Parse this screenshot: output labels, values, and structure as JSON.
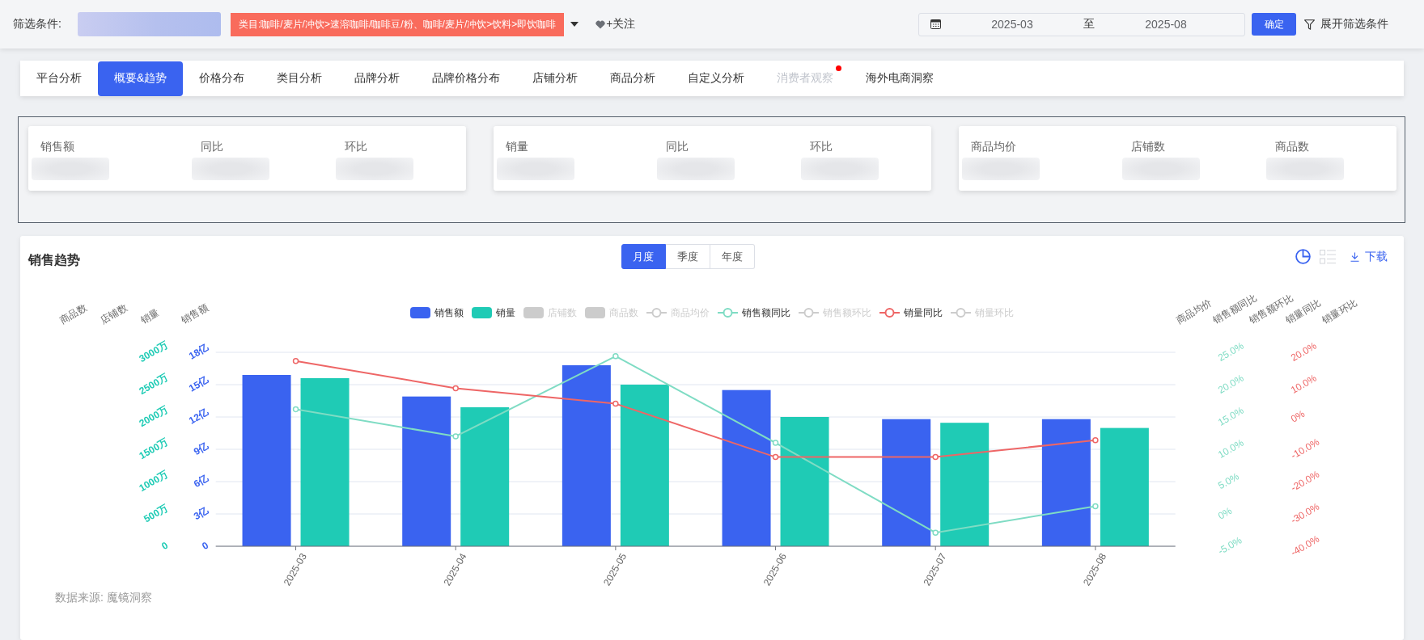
{
  "filter_bar": {
    "label": "筛选条件:",
    "category_tag": "类目:咖啡/麦片/冲饮>速溶咖啡/咖啡豆/粉、咖啡/麦片/冲饮>饮料>即饮咖啡",
    "follow": "+关注",
    "date_range": {
      "start": "2025-03",
      "separator": "至",
      "end": "2025-08"
    },
    "confirm": "确定",
    "expand": "展开筛选条件"
  },
  "tabs": [
    {
      "label": "平台分析",
      "selected": false,
      "disabled": false,
      "dot": false
    },
    {
      "label": "概要&趋势",
      "selected": true,
      "disabled": false,
      "dot": false
    },
    {
      "label": "价格分布",
      "selected": false,
      "disabled": false,
      "dot": false
    },
    {
      "label": "类目分析",
      "selected": false,
      "disabled": false,
      "dot": false
    },
    {
      "label": "品牌分析",
      "selected": false,
      "disabled": false,
      "dot": false
    },
    {
      "label": "品牌价格分布",
      "selected": false,
      "disabled": false,
      "dot": false
    },
    {
      "label": "店铺分析",
      "selected": false,
      "disabled": false,
      "dot": false
    },
    {
      "label": "商品分析",
      "selected": false,
      "disabled": false,
      "dot": false
    },
    {
      "label": "自定义分析",
      "selected": false,
      "disabled": false,
      "dot": false
    },
    {
      "label": "消费者观察",
      "selected": false,
      "disabled": true,
      "dot": true
    },
    {
      "label": "海外电商洞察",
      "selected": false,
      "disabled": false,
      "dot": false
    }
  ],
  "kpi_cards": [
    {
      "metrics": [
        "销售额",
        "同比",
        "环比"
      ]
    },
    {
      "metrics": [
        "销量",
        "同比",
        "环比"
      ]
    },
    {
      "metrics": [
        "商品均价",
        "店铺数",
        "商品数"
      ]
    }
  ],
  "chart_panel": {
    "title": "销售趋势",
    "periods": [
      {
        "label": "月度",
        "selected": true
      },
      {
        "label": "季度",
        "selected": false
      },
      {
        "label": "年度",
        "selected": false
      }
    ],
    "view_modes": [
      {
        "kind": "chart",
        "selected": true
      },
      {
        "kind": "table",
        "selected": false
      }
    ],
    "download": "下载",
    "legend": [
      {
        "on": true
      },
      {
        "on": true
      },
      {
        "label": "店铺数",
        "kind": "bar",
        "on": false
      },
      {
        "label": "商品数",
        "kind": "bar",
        "on": false
      },
      {
        "label": "商品均价",
        "kind": "line",
        "on": false
      },
      {
        "on": true
      },
      {
        "label": "销售额环比",
        "kind": "line",
        "on": false
      },
      {
        "on": true
      },
      {
        "label": "销量环比",
        "kind": "line",
        "on": false
      }
    ],
    "left_axis_titles": [
      "商品数",
      "店铺数",
      "销量",
      "销售额"
    ],
    "right_axis_titles": [
      "商品均价",
      "销售额同比",
      "销售额环比",
      "销量同比",
      "销量环比"
    ],
    "bar_layer": {
      "chart_data": {
        "type": "bar",
        "grid": true,
        "categories": [
          "2025-03",
          "2025-04",
          "2025-05",
          "2025-06",
          "2025-07",
          "2025-08"
        ],
        "series": [
          {
            "name": "销售额",
            "color": "#3a63f0",
            "values": [
              15.9,
              13.9,
              16.8,
              14.5,
              11.8,
              11.8
            ]
          },
          {
            "name": "销量",
            "color": "#1fcbb5",
            "axis": "y2",
            "values": [
              2600,
              2150,
              2500,
              2000,
              1910,
              1830
            ]
          }
        ],
        "ylim": [
          0,
          18
        ],
        "yticks": [
          {
            "value": 0,
            "label": "0"
          },
          {
            "value": 3,
            "label": "3亿"
          },
          {
            "value": 6,
            "label": "6亿"
          },
          {
            "value": 9,
            "label": "9亿"
          },
          {
            "value": 12,
            "label": "12亿"
          },
          {
            "value": 15,
            "label": "15亿"
          },
          {
            "value": 18,
            "label": "18亿"
          }
        ],
        "y2lim": [
          0,
          3000
        ],
        "y2ticks": [
          {
            "value": 0,
            "label": "0"
          },
          {
            "value": 500,
            "label": "500万"
          },
          {
            "value": 1000,
            "label": "1000万"
          },
          {
            "value": 1500,
            "label": "1500万"
          },
          {
            "value": 2000,
            "label": "2000万"
          },
          {
            "value": 2500,
            "label": "2500万"
          },
          {
            "value": 3000,
            "label": "3000万"
          }
        ]
      }
    },
    "line_layer": {
      "chart_data": {
        "type": "line",
        "categories": [
          null,
          null,
          null,
          null,
          null,
          null
        ],
        "series": [
          {
            "name": "销售额同比",
            "color": "#7fdcc4",
            "marker": "circle",
            "values": [
              16.2,
              12.0,
              24.4,
              11.0,
              -2.9,
              1.2
            ]
          },
          {
            "name": "销量同比",
            "color": "#ee6666",
            "marker": "circle",
            "axis": "y2",
            "values": [
              17.3,
              8.9,
              4.1,
              -12.4,
              -12.4,
              -7.2
            ]
          }
        ],
        "ylim": [
          -5,
          25
        ],
        "yticks": [
          {
            "value": -5,
            "label": "-5.0%"
          },
          {
            "value": 0,
            "label": "0%"
          },
          {
            "value": 5,
            "label": "5.0%"
          },
          {
            "value": 10,
            "label": "10.0%"
          },
          {
            "value": 15,
            "label": "15.0%"
          },
          {
            "value": 20,
            "label": "20.0%"
          },
          {
            "value": 25,
            "label": "25.0%"
          }
        ],
        "y2lim": [
          -40,
          20
        ],
        "y2ticks": [
          {
            "value": -40,
            "label": "-40.0%"
          },
          {
            "value": -30,
            "label": "-30.0%"
          },
          {
            "value": -20,
            "label": "-20.0%"
          },
          {
            "value": -10,
            "label": "-10.0%"
          },
          {
            "value": 0,
            "label": "0%"
          },
          {
            "value": 10,
            "label": "10.0%"
          },
          {
            "value": 20,
            "label": "20.0%"
          }
        ]
      }
    },
    "source": "数据来源: 魔镜洞察"
  }
}
